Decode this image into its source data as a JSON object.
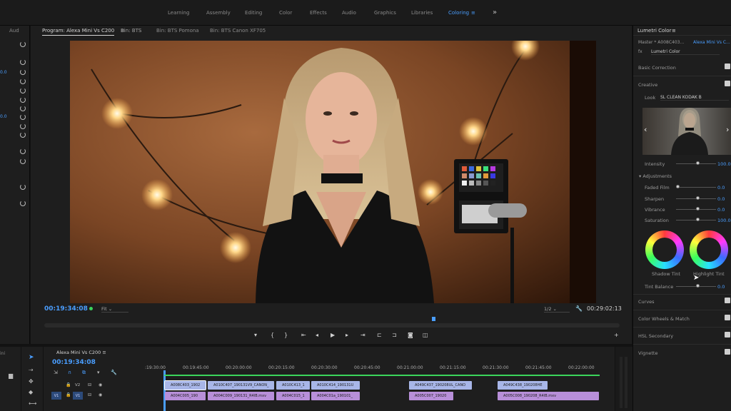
{
  "workspaces": [
    "Learning",
    "Assembly",
    "Editing",
    "Color",
    "Effects",
    "Audio",
    "Graphics",
    "Libraries",
    "Coloring"
  ],
  "active_workspace": "Coloring",
  "more_glyph": "»",
  "left_panel": {
    "tab": "Aud",
    "values": [
      "0.0",
      "0.0"
    ]
  },
  "monitor": {
    "tabs": [
      "Program: Alexa Mini Vs C200",
      "Bin: BTS",
      "Bin: BTS Pomona",
      "Bin: BTS Canon XF705"
    ],
    "menu_glyph": "≡",
    "current_timecode": "00:19:34:08",
    "fit_label": "Fit",
    "resolution": "1/2",
    "duration": "00:29:02:13"
  },
  "lumetri": {
    "title": "Lumetri Color",
    "menu_glyph": "≡",
    "master": "Master * A008C403...",
    "sequence": "Alexa Mini Vs C...",
    "fx_label": "fx",
    "effect_name": "Lumetri Color",
    "sections": {
      "basic_correction": "Basic Correction",
      "creative": "Creative",
      "curves": "Curves",
      "color_wheels": "Color Wheels & Match",
      "hsl_secondary": "HSL Secondary",
      "vignette": "Vignette"
    },
    "look_label": "Look",
    "look_value": "SL CLEAN KODAK B",
    "intensity_label": "Intensity",
    "intensity_value": "100.0",
    "adjustments_label": "Adjustments",
    "faded_film_label": "Faded Film",
    "faded_film_value": "0.0",
    "sharpen_label": "Sharpen",
    "sharpen_value": "0.0",
    "vibrance_label": "Vibrance",
    "vibrance_value": "0.0",
    "saturation_label": "Saturation",
    "saturation_value": "100.0",
    "shadow_tint_label": "Shadow Tint",
    "highlight_tint_label": "Highlight Tint",
    "tint_balance_label": "Tint Balance",
    "tint_balance_value": "0.0"
  },
  "timeline": {
    "tab": "Alexa Mini Vs C200",
    "menu_glyph": "≡",
    "timecode": "00:19:34:08",
    "ruler": [
      ":19:30:00",
      "00:19:45:00",
      "00:20:00:00",
      "00:20:15:00",
      "00:20:30:00",
      "00:20:45:00",
      "00:21:00:00",
      "00:21:15:00",
      "00:21:30:00",
      "00:21:45:00",
      "00:22:00:00"
    ],
    "track_v2": "V2",
    "track_v1": "V1",
    "clips_v2": [
      "A008C403_1902",
      "A010C407_190131V9_CANON_",
      "A010C413_1",
      "A010C414_190131U",
      "A049C437_190208UL_CANO",
      "A049C438_190208HE"
    ],
    "clips_v1": [
      "A004C005_190",
      "A004C009_190131_R4IB.mxv",
      "A004C015_1",
      "A004C01a_190101_",
      "A005C007_19020",
      "A005C008_190208_R4IB.mxv"
    ]
  },
  "colors": {
    "accent": "#4a9eff",
    "panel": "#1e1e1e",
    "clip_v2": "#a8b6e8",
    "clip_v1": "#b88fd9"
  }
}
